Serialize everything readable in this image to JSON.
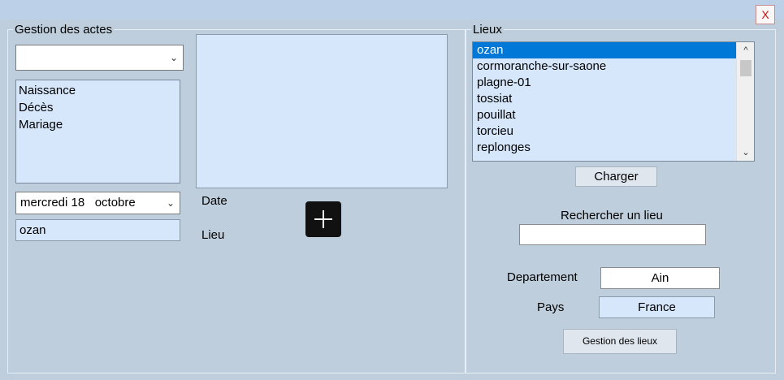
{
  "window": {
    "close_label": "X"
  },
  "actes": {
    "legend": "Gestion des actes",
    "type_combo_value": "",
    "types": [
      "Naissance",
      "Décès",
      "Mariage"
    ],
    "date_value": "mercredi 18   octobre",
    "date_label": "Date",
    "lieu_value": "ozan",
    "lieu_label": "Lieu"
  },
  "lieux": {
    "legend": "Lieux",
    "items": [
      "ozan",
      "cormoranche-sur-saone",
      "plagne-01",
      "tossiat",
      "pouillat",
      "torcieu",
      "replonges"
    ],
    "selected_index": 0,
    "charger_label": "Charger",
    "search_label": "Rechercher un lieu",
    "search_value": "",
    "departement_label": "Departement",
    "departement_value": "Ain",
    "pays_label": "Pays",
    "pays_value": "France",
    "gestion_label": "Gestion des lieux"
  }
}
